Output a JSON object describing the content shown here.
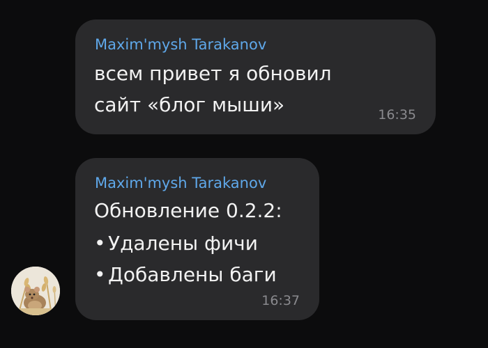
{
  "messages": [
    {
      "sender": "Maxim'mysh Tarakanov",
      "lines": [
        "всем привет я обновил",
        "сайт «блог мыши»"
      ],
      "time": "16:35"
    },
    {
      "sender": "Maxim'mysh Tarakanov",
      "title": "Обновление 0.2.2:",
      "bullet": "•",
      "items": [
        "Удалены фичи",
        "Добавлены баги"
      ],
      "time": "16:37"
    }
  ],
  "avatar": {
    "icon": "mouse-in-wheat-avatar"
  },
  "colors": {
    "background": "#0c0c0d",
    "bubble": "#2a2a2c",
    "sender": "#5fa8ea",
    "text": "#f2f2f2",
    "time": "#8a8a8e"
  }
}
